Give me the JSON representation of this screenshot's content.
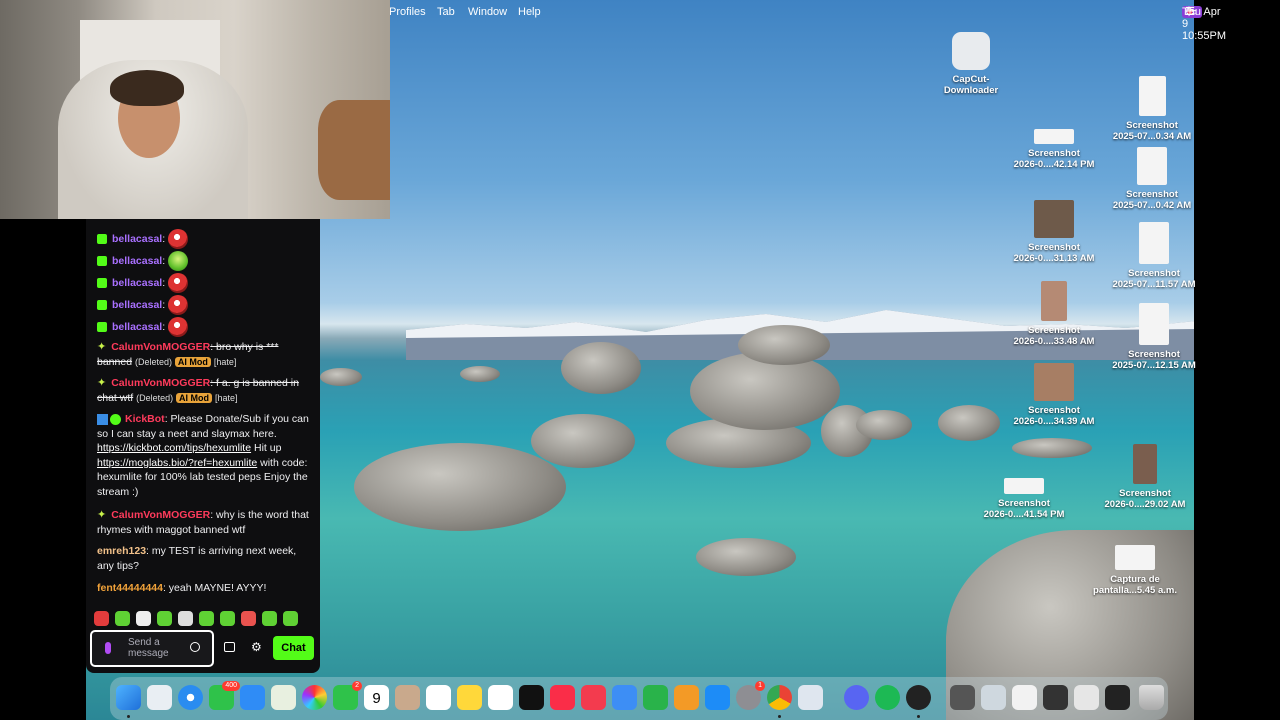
{
  "menubar": {
    "items": [
      "Profiles",
      "Tab",
      "Window",
      "Help"
    ],
    "clock": "Thu Apr 9  10:55PM"
  },
  "desktop_icons": [
    {
      "label1": "CapCut-",
      "label2": "Downloader"
    },
    {
      "label1": "Screenshot",
      "label2": "2025-07...0.34 AM"
    },
    {
      "label1": "Screenshot",
      "label2": "2026-0....42.14 PM"
    },
    {
      "label1": "Screenshot",
      "label2": "2025-07...0.42 AM"
    },
    {
      "label1": "Screenshot",
      "label2": "2026-0....31.13 AM"
    },
    {
      "label1": "Screenshot",
      "label2": "2025-07...11.57 AM"
    },
    {
      "label1": "Screenshot",
      "label2": "2026-0....33.48 AM"
    },
    {
      "label1": "Screenshot",
      "label2": "2025-07...12.15 AM"
    },
    {
      "label1": "Screenshot",
      "label2": "2026-0....34.39 AM"
    },
    {
      "label1": "Screenshot",
      "label2": "2026-0....41.54 PM"
    },
    {
      "label1": "Screenshot",
      "label2": "2026-0....29.02 AM"
    },
    {
      "label1": "Captura de",
      "label2": "pantalla...5.45 a.m."
    }
  ],
  "chat": {
    "messages": [
      {
        "user": "bellacasal",
        "text": ":"
      },
      {
        "user": "bellacasal",
        "text": ":"
      },
      {
        "user": "bellacasal",
        "text": ":"
      },
      {
        "user": "bellacasal",
        "text": ":"
      },
      {
        "user": "bellacasal",
        "text": ":"
      },
      {
        "user": "CalumVonMOGGER",
        "text": ": bro why is *** banned",
        "deleted": "(Deleted)",
        "mod": "AI Mod",
        "tag": "[hate]"
      },
      {
        "user": "CalumVonMOGGER",
        "text": ": f a. g is banned in chat wtf",
        "deleted": "(Deleted)",
        "mod": "AI Mod",
        "tag": "[hate]"
      },
      {
        "user": "KickBot",
        "text": ": Please Donate/Sub if you can so I can stay a neet and slaymax here.",
        "link1": "https://kickbot.com/tips/hexumlite",
        "mid": " Hit up ",
        "link2": "https://moglabs.bio/?ref=hexumlite",
        "tail": " with code: hexumlite for 100% lab tested peps Enjoy the stream :)"
      },
      {
        "user": "CalumVonMOGGER",
        "text": ": why is the word that rhymes with maggot banned wtf"
      },
      {
        "user": "emreh123",
        "text": ": my TEST is arriving next week, any tips?"
      },
      {
        "user": "fent44444444",
        "text": ": yeah MAYNE! AYYY!"
      }
    ],
    "input_placeholder": "Send a message",
    "chat_button": "Chat"
  },
  "dock": {
    "badges": {
      "mail": "400",
      "messages": "2",
      "settings": "1"
    },
    "calendar_day": "9"
  },
  "colors": {
    "kick_green": "#53fc18",
    "user_purple": "#a970ff",
    "user_red": "#ff3b5c",
    "user_orange": "#f2a33a"
  }
}
